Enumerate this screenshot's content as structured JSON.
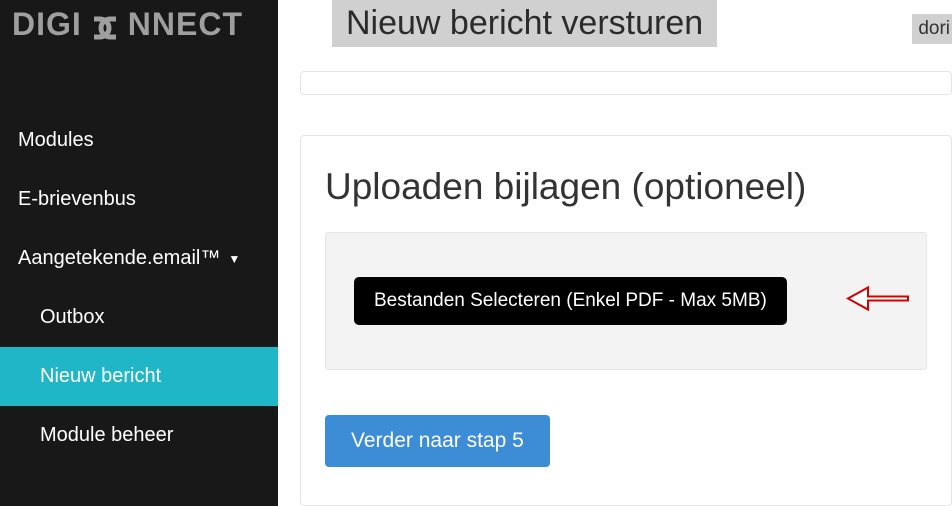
{
  "brand": {
    "prefix": "DIGI",
    "suffix": "NNECT"
  },
  "sidebar": {
    "items": [
      {
        "label": "Modules"
      },
      {
        "label": "E-brievenbus"
      },
      {
        "label": "Aangetekende.email™",
        "expandable": true
      },
      {
        "label": "Outbox"
      },
      {
        "label": "Nieuw bericht"
      },
      {
        "label": "Module beheer"
      }
    ]
  },
  "header": {
    "title": "Nieuw bericht versturen",
    "user_fragment": "dori"
  },
  "main": {
    "upload_heading": "Uploaden bijlagen (optioneel)",
    "select_files_label": "Bestanden Selecteren (Enkel PDF - Max 5MB)",
    "next_label": "Verder naar stap 5"
  }
}
